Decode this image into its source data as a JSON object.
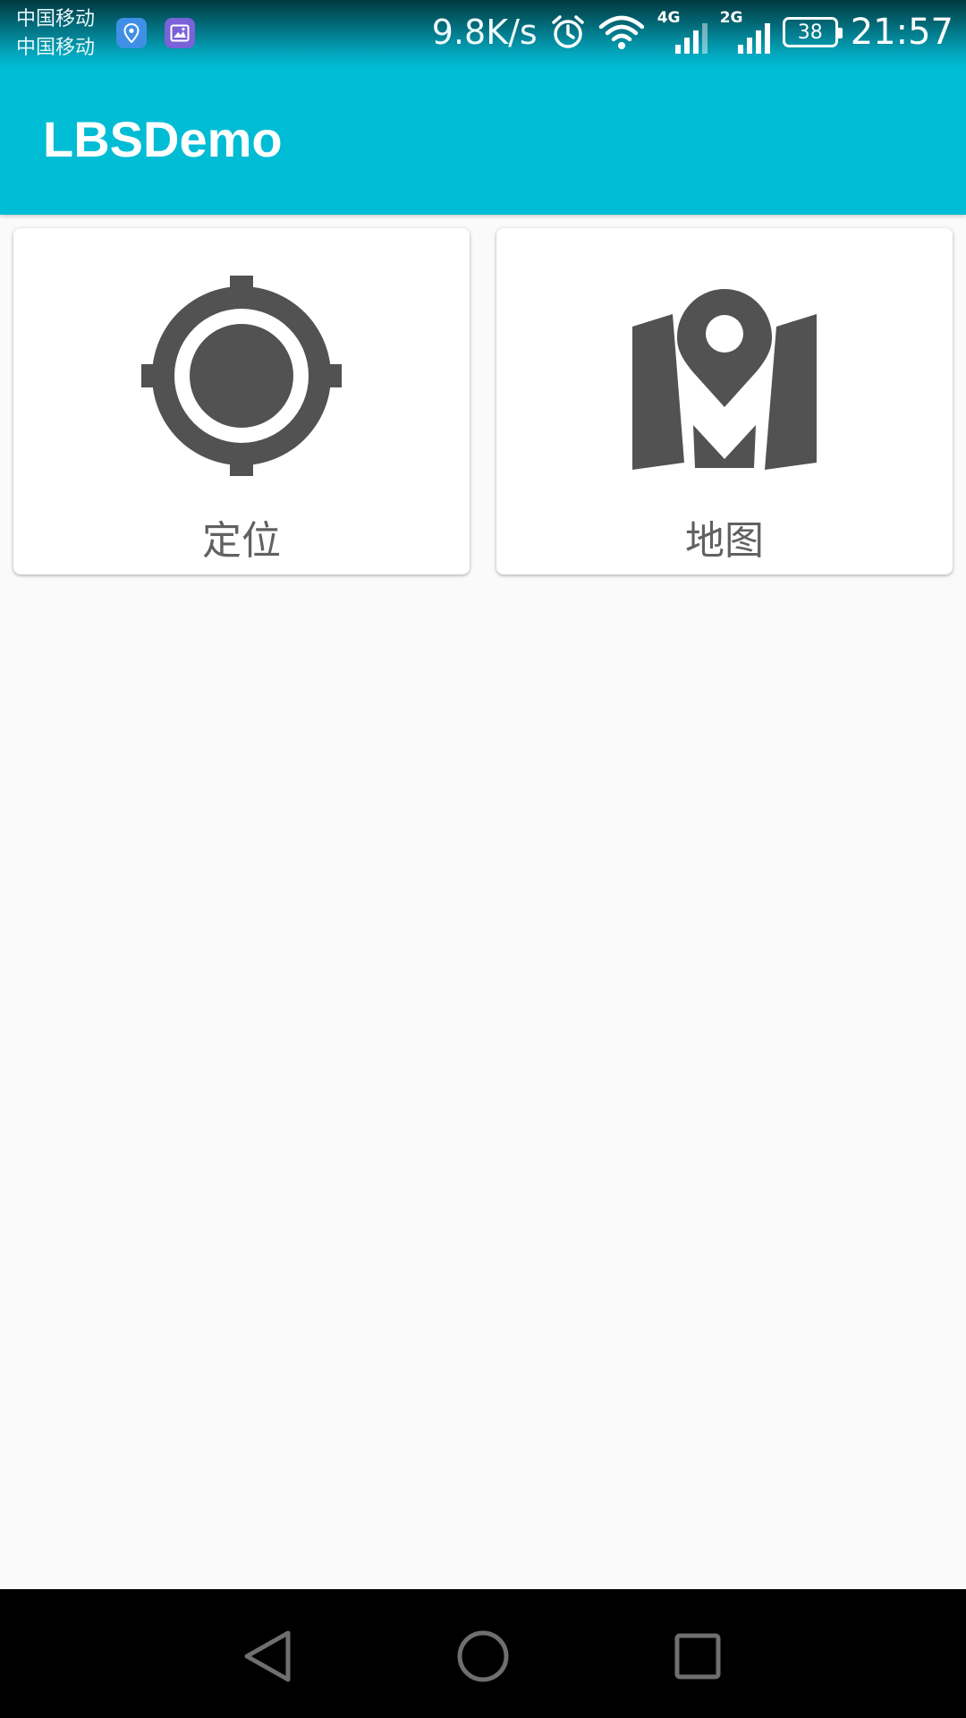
{
  "status_bar": {
    "carriers": [
      "中国移动",
      "中国移动"
    ],
    "notification_icons": [
      "location-icon",
      "gallery-icon"
    ],
    "net_speed": "9.8K/s",
    "alarm_icon": "alarm-icon",
    "wifi_icon": "wifi-icon",
    "signal_1_label": "4G",
    "signal_2_label": "2G",
    "battery_level": "38",
    "time": "21:57"
  },
  "app_bar": {
    "title": "LBSDemo",
    "color": "#00bcd4"
  },
  "cards": [
    {
      "label": "定位",
      "icon": "gps-crosshair-icon"
    },
    {
      "label": "地图",
      "icon": "map-pin-icon"
    }
  ],
  "nav_bar": {
    "buttons": [
      "back-icon",
      "home-icon",
      "recent-apps-icon"
    ]
  },
  "colors": {
    "accent": "#00bcd4",
    "icon_gray": "#525252",
    "label_gray": "#616161",
    "background": "#fafafa"
  }
}
